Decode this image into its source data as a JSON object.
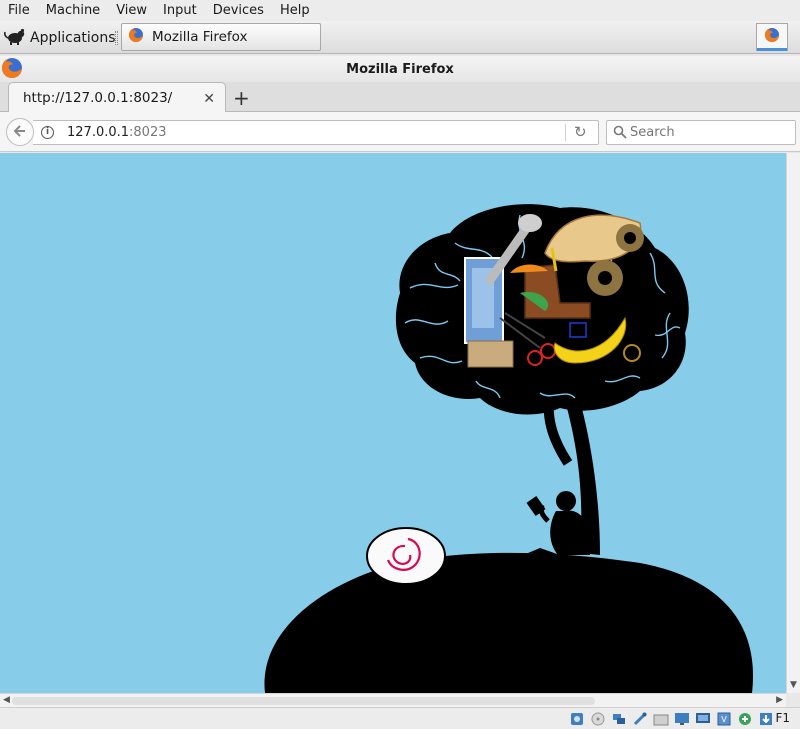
{
  "vbox_menu": [
    "File",
    "Machine",
    "View",
    "Input",
    "Devices",
    "Help"
  ],
  "panel": {
    "applications_label": "Applications",
    "task_title": "Mozilla Firefox"
  },
  "window": {
    "title": "Mozilla Firefox"
  },
  "tab": {
    "title": "http://127.0.0.1:8023/"
  },
  "urlbar": {
    "host": "127.0.0.1",
    "port": ":8023"
  },
  "searchbar": {
    "placeholder": "Search"
  },
  "statusbar": {
    "host_key": "F1",
    "icons": [
      "hard-disk-icon",
      "optical-drive-icon",
      "network-icon",
      "usb-icon",
      "shared-folder-icon",
      "display-icon",
      "video-capture-icon",
      "cpu-icon",
      "mouse-integration-icon",
      "keyboard-capture-icon"
    ]
  },
  "colors": {
    "sky": "#87cdea",
    "silhouette": "#000000",
    "brain_vein": "#7ec8ee",
    "debian_red": "#d70a53"
  },
  "content": {
    "scene": "wallpaper-brain-tree"
  }
}
